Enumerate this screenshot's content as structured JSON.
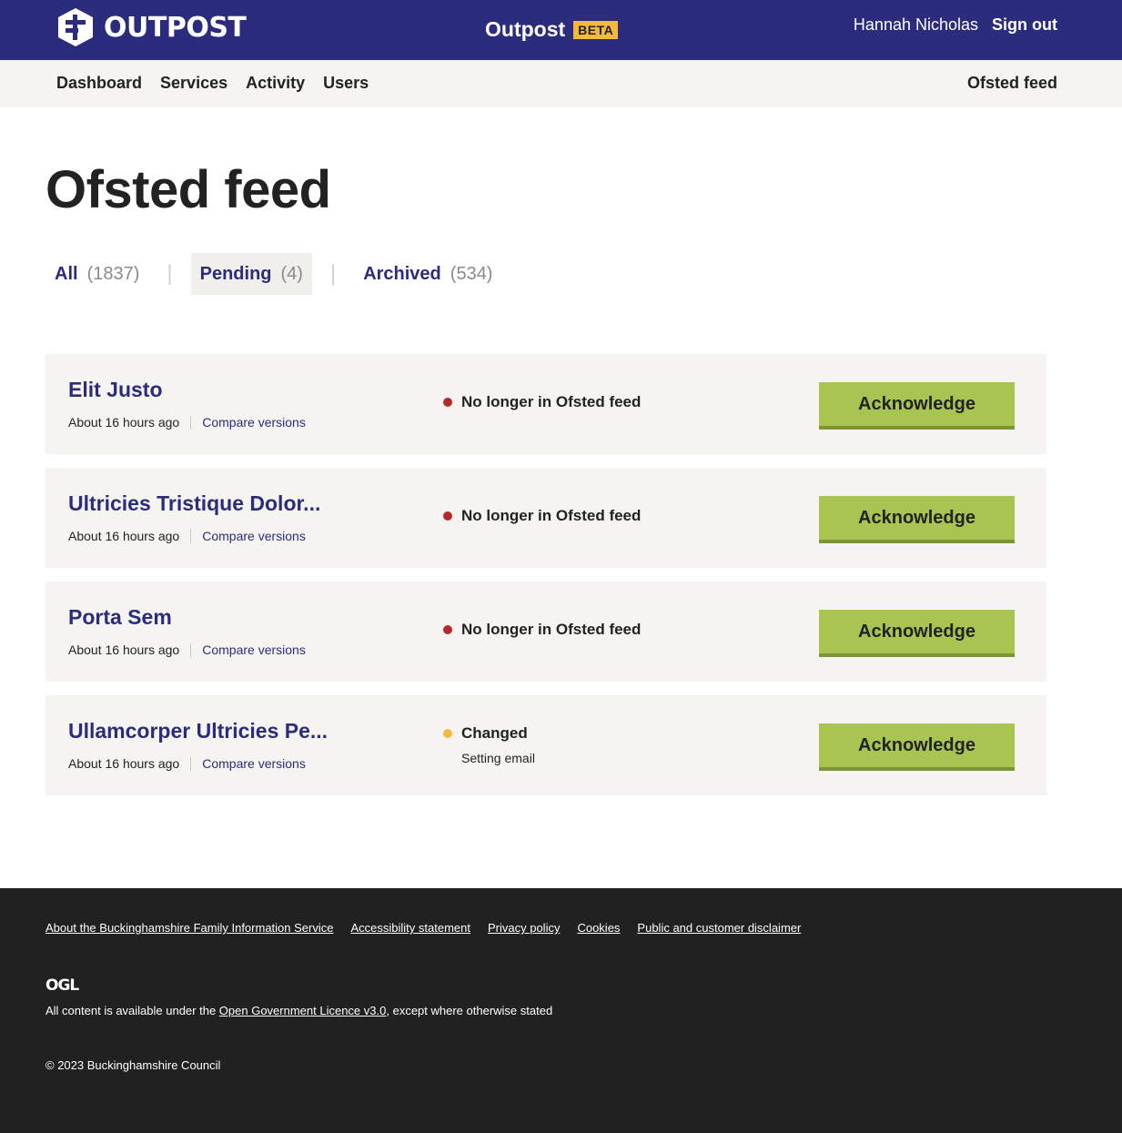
{
  "header": {
    "logo_text": "OUTPOST",
    "product_name": "Outpost",
    "product_tag": "BETA",
    "user_name": "Hannah Nicholas",
    "signout_label": "Sign out"
  },
  "nav": {
    "items": [
      "Dashboard",
      "Services",
      "Activity",
      "Users"
    ],
    "right_label": "Ofsted feed"
  },
  "page": {
    "title": "Ofsted feed"
  },
  "filters": [
    {
      "label": "All",
      "count": "(1837)"
    },
    {
      "label": "Pending",
      "count": "(4)"
    },
    {
      "label": "Archived",
      "count": "(534)"
    }
  ],
  "items": [
    {
      "name": "Elit Justo",
      "time": "About 16 hours ago",
      "compare": "Compare versions",
      "status": "No longer in Ofsted feed",
      "status_detail": "",
      "button": "Acknowledge"
    },
    {
      "name": "Ultricies Tristique Dolor...",
      "time": "About 16 hours ago",
      "compare": "Compare versions",
      "status": "No longer in Ofsted feed",
      "status_detail": "",
      "button": "Acknowledge"
    },
    {
      "name": "Porta Sem",
      "time": "About 16 hours ago",
      "compare": "Compare versions",
      "status": "No longer in Ofsted feed",
      "status_detail": "",
      "button": "Acknowledge"
    },
    {
      "name": "Ullamcorper Ultricies Pe...",
      "time": "About 16 hours ago",
      "compare": "Compare versions",
      "status": "Changed",
      "status_detail": "Setting email",
      "button": "Acknowledge"
    }
  ],
  "footer": {
    "links": [
      "About the Buckinghamshire Family Information Service",
      "Accessibility statement",
      "Privacy policy",
      "Cookies",
      "Public and customer disclaimer"
    ],
    "ogl_text": "OGL",
    "licence_prefix": "All content is available under the ",
    "licence_link": "Open Government Licence v3.0",
    "licence_suffix": ", except where otherwise stated",
    "copyright": "© 2023 Buckinghamshire Council"
  },
  "colors": {
    "brand": "#2c2c7f",
    "beta": "#f3b93b",
    "button": "#a8c551",
    "status_removed": "#b3282a",
    "status_changed": "#f3b93b",
    "footer_bg": "#212121"
  }
}
